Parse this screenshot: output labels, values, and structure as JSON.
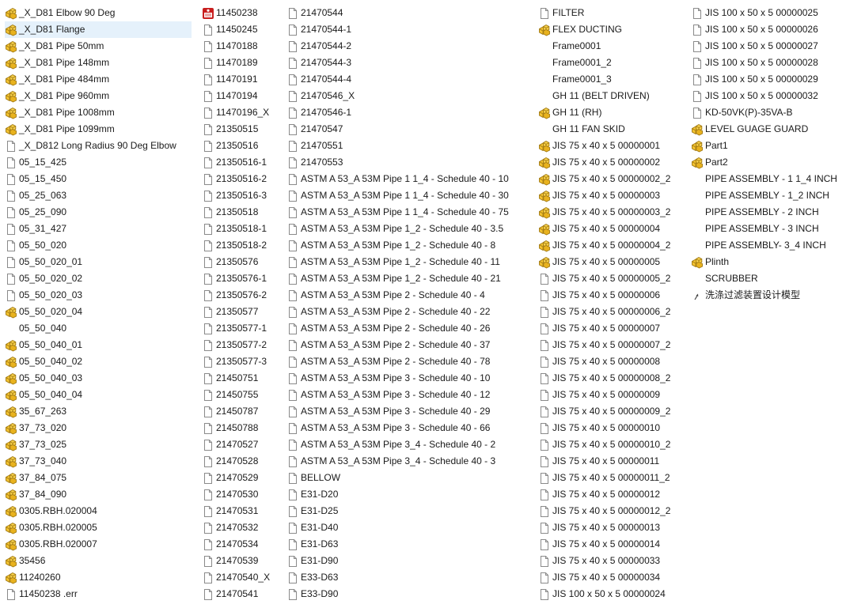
{
  "columns": [
    {
      "items": [
        {
          "label": "_X_D81 Elbow 90 Deg",
          "icon": "assembly-icon"
        },
        {
          "label": "_X_D81 Flange",
          "icon": "assembly-icon",
          "selected": true
        },
        {
          "label": "_X_D81 Pipe 50mm",
          "icon": "assembly-icon"
        },
        {
          "label": "_X_D81 Pipe 148mm",
          "icon": "assembly-icon"
        },
        {
          "label": "_X_D81 Pipe 484mm",
          "icon": "assembly-icon"
        },
        {
          "label": "_X_D81 Pipe 960mm",
          "icon": "assembly-icon"
        },
        {
          "label": "_X_D81 Pipe 1008mm",
          "icon": "assembly-icon"
        },
        {
          "label": "_X_D81 Pipe 1099mm",
          "icon": "assembly-icon"
        },
        {
          "label": "_X_D812 Long Radius 90 Deg Elbow",
          "icon": "file-icon"
        },
        {
          "label": "05_15_425",
          "icon": "file-icon"
        },
        {
          "label": "05_15_450",
          "icon": "file-icon"
        },
        {
          "label": "05_25_063",
          "icon": "file-icon"
        },
        {
          "label": "05_25_090",
          "icon": "file-icon"
        },
        {
          "label": "05_31_427",
          "icon": "file-icon"
        },
        {
          "label": "05_50_020",
          "icon": "file-icon"
        },
        {
          "label": "05_50_020_01",
          "icon": "file-icon"
        },
        {
          "label": "05_50_020_02",
          "icon": "file-icon"
        },
        {
          "label": "05_50_020_03",
          "icon": "file-icon"
        },
        {
          "label": "05_50_020_04",
          "icon": "assembly-icon"
        },
        {
          "label": "05_50_040",
          "icon": "none"
        },
        {
          "label": "05_50_040_01",
          "icon": "assembly-icon"
        },
        {
          "label": "05_50_040_02",
          "icon": "assembly-icon"
        },
        {
          "label": "05_50_040_03",
          "icon": "assembly-icon"
        },
        {
          "label": "05_50_040_04",
          "icon": "assembly-icon"
        },
        {
          "label": "35_67_263",
          "icon": "assembly-icon"
        },
        {
          "label": "37_73_020",
          "icon": "assembly-icon"
        },
        {
          "label": "37_73_025",
          "icon": "assembly-icon"
        },
        {
          "label": "37_73_040",
          "icon": "assembly-icon"
        },
        {
          "label": "37_84_075",
          "icon": "assembly-icon"
        },
        {
          "label": "37_84_090",
          "icon": "assembly-icon"
        },
        {
          "label": "0305.RBH.020004",
          "icon": "assembly-icon"
        },
        {
          "label": "0305.RBH.020005",
          "icon": "assembly-icon"
        },
        {
          "label": "0305.RBH.020007",
          "icon": "assembly-icon"
        },
        {
          "label": "35456",
          "icon": "assembly-icon"
        },
        {
          "label": "11240260",
          "icon": "assembly-icon"
        },
        {
          "label": "11450238 .err",
          "icon": "file-icon"
        }
      ]
    },
    {
      "items": [
        {
          "label": "11450238",
          "icon": "app-icon"
        },
        {
          "label": "11450245",
          "icon": "file-icon"
        },
        {
          "label": "11470188",
          "icon": "file-icon"
        },
        {
          "label": "11470189",
          "icon": "file-icon"
        },
        {
          "label": "11470191",
          "icon": "file-icon"
        },
        {
          "label": "11470194",
          "icon": "file-icon"
        },
        {
          "label": "11470196_X",
          "icon": "file-icon"
        },
        {
          "label": "21350515",
          "icon": "file-icon"
        },
        {
          "label": "21350516",
          "icon": "file-icon"
        },
        {
          "label": "21350516-1",
          "icon": "file-icon"
        },
        {
          "label": "21350516-2",
          "icon": "file-icon"
        },
        {
          "label": "21350516-3",
          "icon": "file-icon"
        },
        {
          "label": "21350518",
          "icon": "file-icon"
        },
        {
          "label": "21350518-1",
          "icon": "file-icon"
        },
        {
          "label": "21350518-2",
          "icon": "file-icon"
        },
        {
          "label": "21350576",
          "icon": "file-icon"
        },
        {
          "label": "21350576-1",
          "icon": "file-icon"
        },
        {
          "label": "21350576-2",
          "icon": "file-icon"
        },
        {
          "label": "21350577",
          "icon": "file-icon"
        },
        {
          "label": "21350577-1",
          "icon": "file-icon"
        },
        {
          "label": "21350577-2",
          "icon": "file-icon"
        },
        {
          "label": "21350577-3",
          "icon": "file-icon"
        },
        {
          "label": "21450751",
          "icon": "file-icon"
        },
        {
          "label": "21450755",
          "icon": "file-icon"
        },
        {
          "label": "21450787",
          "icon": "file-icon"
        },
        {
          "label": "21450788",
          "icon": "file-icon"
        },
        {
          "label": "21470527",
          "icon": "file-icon"
        },
        {
          "label": "21470528",
          "icon": "file-icon"
        },
        {
          "label": "21470529",
          "icon": "file-icon"
        },
        {
          "label": "21470530",
          "icon": "file-icon"
        },
        {
          "label": "21470531",
          "icon": "file-icon"
        },
        {
          "label": "21470532",
          "icon": "file-icon"
        },
        {
          "label": "21470534",
          "icon": "file-icon"
        },
        {
          "label": "21470539",
          "icon": "file-icon"
        },
        {
          "label": "21470540_X",
          "icon": "file-icon"
        },
        {
          "label": "21470541",
          "icon": "file-icon"
        }
      ]
    },
    {
      "items": [
        {
          "label": "21470544",
          "icon": "file-icon"
        },
        {
          "label": "21470544-1",
          "icon": "file-icon"
        },
        {
          "label": "21470544-2",
          "icon": "file-icon"
        },
        {
          "label": "21470544-3",
          "icon": "file-icon"
        },
        {
          "label": "21470544-4",
          "icon": "file-icon"
        },
        {
          "label": "21470546_X",
          "icon": "file-icon"
        },
        {
          "label": "21470546-1",
          "icon": "file-icon"
        },
        {
          "label": "21470547",
          "icon": "file-icon"
        },
        {
          "label": "21470551",
          "icon": "file-icon"
        },
        {
          "label": "21470553",
          "icon": "file-icon"
        },
        {
          "label": "ASTM A 53_A 53M Pipe 1 1_4 - Schedule 40 - 10",
          "icon": "file-icon"
        },
        {
          "label": "ASTM A 53_A 53M Pipe 1 1_4 - Schedule 40 - 30",
          "icon": "file-icon"
        },
        {
          "label": "ASTM A 53_A 53M Pipe 1 1_4 - Schedule 40 - 75",
          "icon": "file-icon"
        },
        {
          "label": "ASTM A 53_A 53M Pipe 1_2 - Schedule 40 - 3.5",
          "icon": "file-icon"
        },
        {
          "label": "ASTM A 53_A 53M Pipe 1_2 - Schedule 40 - 8",
          "icon": "file-icon"
        },
        {
          "label": "ASTM A 53_A 53M Pipe 1_2 - Schedule 40 - 11",
          "icon": "file-icon"
        },
        {
          "label": "ASTM A 53_A 53M Pipe 1_2 - Schedule 40 - 21",
          "icon": "file-icon"
        },
        {
          "label": "ASTM A 53_A 53M Pipe 2 - Schedule 40 - 4",
          "icon": "file-icon"
        },
        {
          "label": "ASTM A 53_A 53M Pipe 2 - Schedule 40 - 22",
          "icon": "file-icon"
        },
        {
          "label": "ASTM A 53_A 53M Pipe 2 - Schedule 40 - 26",
          "icon": "file-icon"
        },
        {
          "label": "ASTM A 53_A 53M Pipe 2 - Schedule 40 - 37",
          "icon": "file-icon"
        },
        {
          "label": "ASTM A 53_A 53M Pipe 2 - Schedule 40 - 78",
          "icon": "file-icon"
        },
        {
          "label": "ASTM A 53_A 53M Pipe 3 - Schedule 40 - 10",
          "icon": "file-icon"
        },
        {
          "label": "ASTM A 53_A 53M Pipe 3 - Schedule 40 - 12",
          "icon": "file-icon"
        },
        {
          "label": "ASTM A 53_A 53M Pipe 3 - Schedule 40 - 29",
          "icon": "file-icon"
        },
        {
          "label": "ASTM A 53_A 53M Pipe 3 - Schedule 40 - 66",
          "icon": "file-icon"
        },
        {
          "label": "ASTM A 53_A 53M Pipe 3_4 - Schedule 40 - 2",
          "icon": "file-icon"
        },
        {
          "label": "ASTM A 53_A 53M Pipe 3_4 - Schedule 40 - 3",
          "icon": "file-icon"
        },
        {
          "label": "BELLOW",
          "icon": "file-icon"
        },
        {
          "label": "E31-D20",
          "icon": "file-icon"
        },
        {
          "label": "E31-D25",
          "icon": "file-icon"
        },
        {
          "label": "E31-D40",
          "icon": "file-icon"
        },
        {
          "label": "E31-D63",
          "icon": "file-icon"
        },
        {
          "label": "E31-D90",
          "icon": "file-icon"
        },
        {
          "label": "E33-D63",
          "icon": "file-icon"
        },
        {
          "label": "E33-D90",
          "icon": "file-icon"
        }
      ]
    },
    {
      "items": [
        {
          "label": "FILTER",
          "icon": "file-icon"
        },
        {
          "label": "FLEX DUCTING",
          "icon": "assembly-icon"
        },
        {
          "label": "Frame0001",
          "icon": "none"
        },
        {
          "label": "Frame0001_2",
          "icon": "none"
        },
        {
          "label": "Frame0001_3",
          "icon": "none"
        },
        {
          "label": "GH 11 (BELT DRIVEN)",
          "icon": "none"
        },
        {
          "label": "GH 11 (RH)",
          "icon": "assembly-icon"
        },
        {
          "label": "GH 11 FAN SKID",
          "icon": "none"
        },
        {
          "label": "JIS 75 x 40 x 5 00000001",
          "icon": "assembly-icon"
        },
        {
          "label": "JIS 75 x 40 x 5 00000002",
          "icon": "assembly-icon"
        },
        {
          "label": "JIS 75 x 40 x 5 00000002_2",
          "icon": "assembly-icon"
        },
        {
          "label": "JIS 75 x 40 x 5 00000003",
          "icon": "assembly-icon"
        },
        {
          "label": "JIS 75 x 40 x 5 00000003_2",
          "icon": "assembly-icon"
        },
        {
          "label": "JIS 75 x 40 x 5 00000004",
          "icon": "assembly-icon"
        },
        {
          "label": "JIS 75 x 40 x 5 00000004_2",
          "icon": "assembly-icon"
        },
        {
          "label": "JIS 75 x 40 x 5 00000005",
          "icon": "assembly-icon"
        },
        {
          "label": "JIS 75 x 40 x 5 00000005_2",
          "icon": "file-icon"
        },
        {
          "label": "JIS 75 x 40 x 5 00000006",
          "icon": "file-icon"
        },
        {
          "label": "JIS 75 x 40 x 5 00000006_2",
          "icon": "file-icon"
        },
        {
          "label": "JIS 75 x 40 x 5 00000007",
          "icon": "file-icon"
        },
        {
          "label": "JIS 75 x 40 x 5 00000007_2",
          "icon": "file-icon"
        },
        {
          "label": "JIS 75 x 40 x 5 00000008",
          "icon": "file-icon"
        },
        {
          "label": "JIS 75 x 40 x 5 00000008_2",
          "icon": "file-icon"
        },
        {
          "label": "JIS 75 x 40 x 5 00000009",
          "icon": "file-icon"
        },
        {
          "label": "JIS 75 x 40 x 5 00000009_2",
          "icon": "file-icon"
        },
        {
          "label": "JIS 75 x 40 x 5 00000010",
          "icon": "file-icon"
        },
        {
          "label": "JIS 75 x 40 x 5 00000010_2",
          "icon": "file-icon"
        },
        {
          "label": "JIS 75 x 40 x 5 00000011",
          "icon": "file-icon"
        },
        {
          "label": "JIS 75 x 40 x 5 00000011_2",
          "icon": "file-icon"
        },
        {
          "label": "JIS 75 x 40 x 5 00000012",
          "icon": "file-icon"
        },
        {
          "label": "JIS 75 x 40 x 5 00000012_2",
          "icon": "file-icon"
        },
        {
          "label": "JIS 75 x 40 x 5 00000013",
          "icon": "file-icon"
        },
        {
          "label": "JIS 75 x 40 x 5 00000014",
          "icon": "file-icon"
        },
        {
          "label": "JIS 75 x 40 x 5 00000033",
          "icon": "file-icon"
        },
        {
          "label": "JIS 75 x 40 x 5 00000034",
          "icon": "file-icon"
        },
        {
          "label": "JIS 100 x 50 x 5 00000024",
          "icon": "file-icon"
        }
      ]
    },
    {
      "items": [
        {
          "label": "JIS 100 x 50 x 5 00000025",
          "icon": "file-icon"
        },
        {
          "label": "JIS 100 x 50 x 5 00000026",
          "icon": "file-icon"
        },
        {
          "label": "JIS 100 x 50 x 5 00000027",
          "icon": "file-icon"
        },
        {
          "label": "JIS 100 x 50 x 5 00000028",
          "icon": "file-icon"
        },
        {
          "label": "JIS 100 x 50 x 5 00000029",
          "icon": "file-icon"
        },
        {
          "label": "JIS 100 x 50 x 5 00000032",
          "icon": "file-icon"
        },
        {
          "label": "KD-50VK(P)-35VA-B",
          "icon": "file-icon"
        },
        {
          "label": "LEVEL GUAGE GUARD",
          "icon": "assembly-icon"
        },
        {
          "label": "Part1",
          "icon": "assembly-icon"
        },
        {
          "label": "Part2",
          "icon": "assembly-icon"
        },
        {
          "label": "PIPE ASSEMBLY - 1 1_4 INCH",
          "icon": "none"
        },
        {
          "label": "PIPE ASSEMBLY - 1_2 INCH",
          "icon": "none"
        },
        {
          "label": "PIPE ASSEMBLY - 2 INCH",
          "icon": "none"
        },
        {
          "label": "PIPE ASSEMBLY - 3 INCH",
          "icon": "none"
        },
        {
          "label": "PIPE ASSEMBLY- 3_4 INCH",
          "icon": "none"
        },
        {
          "label": "Plinth",
          "icon": "assembly-icon"
        },
        {
          "label": "SCRUBBER",
          "icon": "none"
        },
        {
          "label": "洗涤过滤装置设计模型",
          "icon": "shortcut-icon"
        }
      ]
    }
  ]
}
